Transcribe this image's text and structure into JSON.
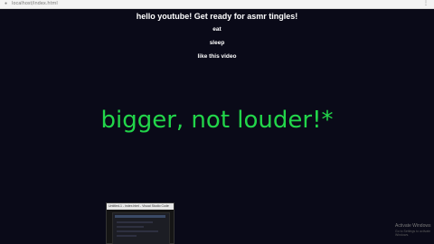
{
  "browser": {
    "url": "localhost/index.html"
  },
  "page": {
    "heading": "hello youtube! Get ready for asmr tingles!",
    "items": [
      "eat",
      "sleep",
      "like this video"
    ],
    "slogan": "bigger, not louder!*"
  },
  "taskbar_preview": {
    "title": "Untitled-1 - index.html - Visual Studio Code"
  },
  "watermark": {
    "line1": "Activate Windows",
    "line2": "Go to Settings to activate Windows."
  },
  "colors": {
    "slogan": "#22d64a",
    "background": "#0a0a18"
  },
  "icons": [
    "lock-icon",
    "menu-icon"
  ]
}
